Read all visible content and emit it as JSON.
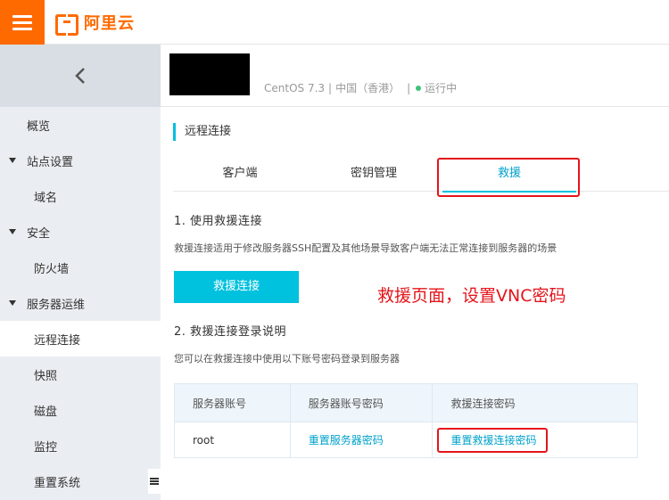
{
  "brand": {
    "logo_text": "阿里云",
    "accent": "#ff6a00"
  },
  "sidebar": {
    "items": [
      {
        "label": "概览"
      },
      {
        "label": "站点设置"
      },
      {
        "label": "域名"
      },
      {
        "label": "安全"
      },
      {
        "label": "防火墙"
      },
      {
        "label": "服务器运维"
      },
      {
        "label": "远程连接"
      },
      {
        "label": "快照"
      },
      {
        "label": "磁盘"
      },
      {
        "label": "监控"
      },
      {
        "label": "重置系统"
      }
    ]
  },
  "instance": {
    "os": "CentOS 7.3",
    "sep1": "|",
    "region": "中国（香港）",
    "sep2": "|",
    "status": "运行中",
    "status_color": "#3ec27c"
  },
  "main": {
    "section_title": "远程连接",
    "tabs": [
      {
        "label": "客户端"
      },
      {
        "label": "密钥管理"
      },
      {
        "label": "救援"
      }
    ],
    "active_tab": "救援",
    "step1_title": "1. 使用救援连接",
    "step1_desc": "救援连接适用于修改服务器SSH配置及其他场景导致客户端无法正常连接到服务器的场景",
    "rescue_button": "救援连接",
    "annotation": "救援页面，设置VNC密码",
    "step2_title": "2. 救援连接登录说明",
    "step2_desc": "您可以在救援连接中使用以下账号密码登录到服务器",
    "table": {
      "headers": [
        "服务器账号",
        "服务器账号密码",
        "救援连接密码"
      ],
      "rows": [
        {
          "account": "root",
          "reset_server_pwd": "重置服务器密码",
          "reset_rescue_pwd": "重置救援连接密码"
        }
      ]
    },
    "highlight_color": "#e4141b"
  }
}
